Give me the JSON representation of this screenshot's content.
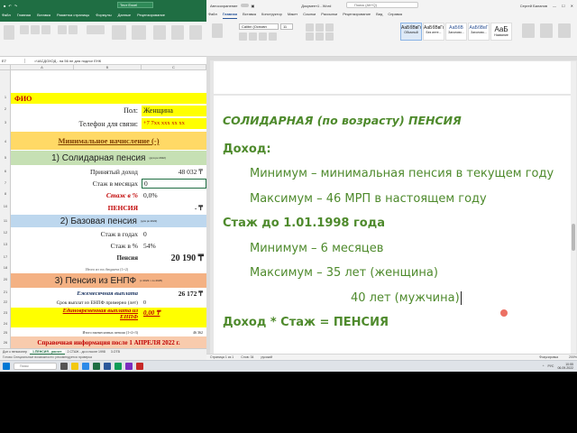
{
  "excel": {
    "title_tabs": [
      "Файл",
      "Главная",
      "Вставка",
      "Разметка страницы",
      "Формулы",
      "Данные",
      "Рецензирование"
    ],
    "name_box": "E7",
    "formula": "=ЧАСДОХОД - на 56 не для подлог ЕНК",
    "column_headers": [
      "A",
      "B",
      "C"
    ],
    "rows": [
      {
        "num": "1",
        "b": "ФИО",
        "c": ""
      },
      {
        "num": "2",
        "b": "Пол:",
        "c": "Женщина"
      },
      {
        "num": "3",
        "b": "Телефон для связи:",
        "c": "+7 7xx xxx xx xx"
      },
      {
        "num": "4",
        "b": "Минимальное начисление (-)",
        "c": ""
      },
      {
        "num": "5",
        "b": "1) Солидарная пенсия",
        "c": ""
      },
      {
        "num": "6",
        "b": "Принятый доход",
        "c": "48 032 ₸"
      },
      {
        "num": "7",
        "b": "Стаж в месяцах",
        "c": "0"
      },
      {
        "num": "8",
        "b": "Стаж в %",
        "c": "0,0%"
      },
      {
        "num": "10",
        "b": "ПЕНСИЯ",
        "c": "- ₸"
      },
      {
        "num": "11",
        "b": "2) Базовая пенсия",
        "c": ""
      },
      {
        "num": "12",
        "b": "Стаж в годах",
        "c": "0"
      },
      {
        "num": "13",
        "b": "Стаж в %",
        "c": "54%"
      },
      {
        "num": "17",
        "b": "Пенсия",
        "c": "20 190 ₸"
      },
      {
        "num": "18",
        "b": "Итого из гос.бюджета (1+2)",
        "c": ""
      },
      {
        "num": "20",
        "b": "3) Пенсия из ЕНПФ",
        "c": ""
      },
      {
        "num": "21",
        "b": "Ежемесячная выплата",
        "c": "26 172 ₸"
      },
      {
        "num": "22",
        "b": "Срок выплат из ЕНПФ примерно (лет)",
        "c": "0"
      },
      {
        "num": "23",
        "b": "Единовременная выплата из",
        "c": ""
      },
      {
        "num": "24",
        "b": "ЕНПФ",
        "c": "0,00 ₸"
      },
      {
        "num": "25",
        "b": "Итого ежемесячных пенсии (1+2+3)",
        "c": "46 362"
      },
      {
        "num": "26",
        "b": "Справочная информация после 1 АПРЕЛЯ 2022 г.",
        "c": ""
      }
    ],
    "section5_small": "(для рк 2022)",
    "section11_small": "(для рк 2022)",
    "section20_small": "(с 2023 г. по 2025)",
    "sheet_tabs": [
      "Доп к пенсионер",
      "1.ПЕНСИЯ - расчет",
      "2.СТАЖ - до и после 1998",
      "3.ОТВ"
    ],
    "status": "Готово   Специальные возможности: рекомендуется проверка"
  },
  "word": {
    "autosave_label": "Автосохранение",
    "doc_title": "Документ1 - Word",
    "search_placeholder": "Поиск (Alt+Q)",
    "user": "Сергей Баланов",
    "tabs": [
      "Файл",
      "Главная",
      "Вставка",
      "Конструктор",
      "Макет",
      "Ссылки",
      "Рассылки",
      "Рецензирование",
      "Вид",
      "Справка"
    ],
    "active_tab": "Главная",
    "font": "Calibri (Основн",
    "font_size": "11",
    "styles": [
      {
        "sample": "АаБбВвГг",
        "name": "Обычный"
      },
      {
        "sample": "АаБбВвГг",
        "name": "Без инте..."
      },
      {
        "sample": "АаБбВ",
        "name": "Заголово..."
      },
      {
        "sample": "АаБбВвГ",
        "name": "Заголово..."
      },
      {
        "sample": "АаБ",
        "name": "Название"
      }
    ],
    "lines": [
      "СОЛИДАРНАЯ (по возрасту) ПЕНСИЯ",
      "Доход:",
      "Минимум – минимальная пенсия в текущем году",
      "Максимум – 46 МРП в настоящем году",
      "Стаж до 1.01.1998 года",
      "Минимум – 6 месяцев",
      "Максимум – 35 лет (женщина)",
      "40 лет (мужчина)",
      "Доход * Стаж = ПЕНСИЯ"
    ],
    "status_page": "Страница 1 из 1",
    "status_words": "Слов: 34",
    "status_lang": "русский",
    "status_focus": "Фокусировка",
    "status_zoom": "200%"
  },
  "taskbar": {
    "search_placeholder": "Поиск",
    "lang": "РУС",
    "time": "10:55",
    "date": "06.09.2022"
  },
  "colors": {
    "excel_green": "#1f6e43",
    "word_text_green": "#4e8a2c",
    "yellow": "#ffff00",
    "orange": "#f4b183",
    "light_blue": "#bdd7ee",
    "light_green": "#c6e0b4"
  }
}
